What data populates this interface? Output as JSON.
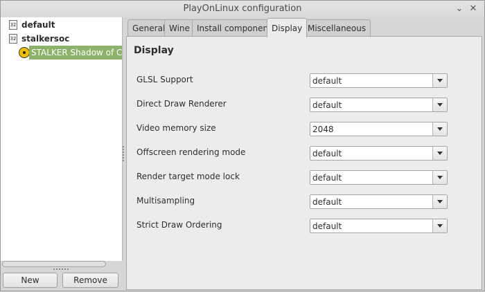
{
  "window": {
    "title": "PlayOnLinux configuration",
    "minimize_glyph": "⌄",
    "close_glyph": "✕"
  },
  "tree": {
    "items": [
      {
        "label": "default",
        "icon": "wine-32-icon",
        "icon_text": "32"
      },
      {
        "label": "stalkersoc",
        "icon": "wine-32-icon",
        "icon_text": "32"
      },
      {
        "label": "STALKER Shadow of Chernobyl",
        "icon": "radiation-icon",
        "selected": true
      }
    ]
  },
  "buttons": {
    "new_label": "New",
    "remove_label": "Remove"
  },
  "tabs": [
    {
      "label": "General"
    },
    {
      "label": "Wine"
    },
    {
      "label": "Install components"
    },
    {
      "label": "Display",
      "active": true
    },
    {
      "label": "Miscellaneous"
    }
  ],
  "panel": {
    "title": "Display",
    "settings": [
      {
        "label": "GLSL Support",
        "value": "default"
      },
      {
        "label": "Direct Draw Renderer",
        "value": "default"
      },
      {
        "label": "Video memory size",
        "value": "2048"
      },
      {
        "label": "Offscreen rendering mode",
        "value": "default"
      },
      {
        "label": "Render target mode lock",
        "value": "default"
      },
      {
        "label": "Multisampling",
        "value": "default"
      },
      {
        "label": "Strict Draw Ordering",
        "value": "default"
      }
    ]
  },
  "colors": {
    "selection": "#8fb26a",
    "window_bg": "#d6d6d6",
    "panel_bg": "#ececec"
  }
}
